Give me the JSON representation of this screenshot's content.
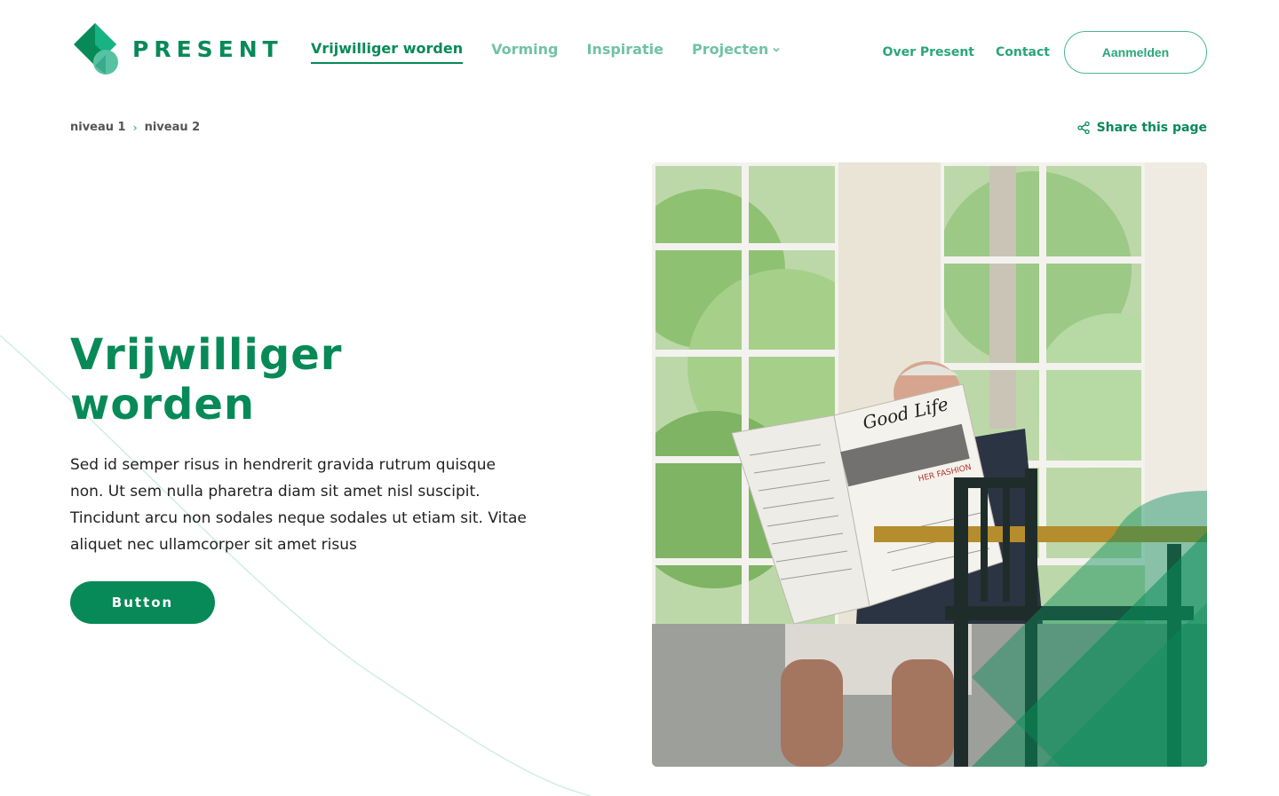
{
  "brand": {
    "name": "PRESENT"
  },
  "nav": {
    "items": [
      {
        "label": "Vrijwilliger worden",
        "active": true
      },
      {
        "label": "Vorming",
        "active": false
      },
      {
        "label": "Inspiratie",
        "active": false
      },
      {
        "label": "Projecten",
        "active": false,
        "has_dropdown": true
      }
    ]
  },
  "utility": {
    "about": "Over Present",
    "contact": "Contact",
    "signup": "Aanmelden"
  },
  "breadcrumb": {
    "level1": "niveau 1",
    "level2": "niveau 2"
  },
  "share": {
    "label": "Share this page",
    "icon": "share-icon"
  },
  "hero": {
    "title_line1": "Vrijwilliger",
    "title_line2": "worden",
    "body": "Sed id semper risus in hendrerit gravida rutrum quisque non. Ut sem nulla pharetra diam sit amet nisl suscipit. Tincidunt arcu non sodales neque sodales ut etiam sit. Vitae aliquet nec ullamcorper sit amet risus",
    "button_label": "Button"
  },
  "photo": {
    "newspaper_headline": "Good Life",
    "newspaper_subhead": "HER FASHION"
  },
  "colors": {
    "brand_green": "#078a58",
    "light_green": "#6fc3a4",
    "teal": "#46b894"
  }
}
